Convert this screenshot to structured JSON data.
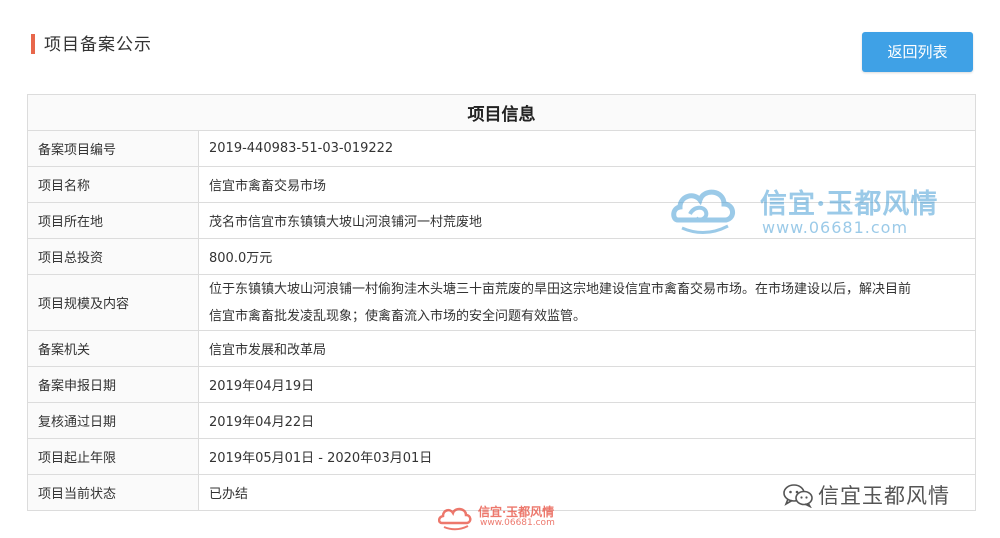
{
  "page": {
    "title": "项目备案公示",
    "back_button": "返回列表"
  },
  "table": {
    "heading": "项目信息",
    "rows": [
      {
        "label": "备案项目编号",
        "value": "2019-440983-51-03-019222"
      },
      {
        "label": "项目名称",
        "value": "信宜市禽畜交易市场"
      },
      {
        "label": "项目所在地",
        "value": "茂名市信宜市东镇镇大坡山河浪铺河一村荒废地"
      },
      {
        "label": "项目总投资",
        "value": "800.0万元"
      },
      {
        "label": "项目规模及内容",
        "value_line1": "位于东镇镇大坡山河浪铺一村偷狗洼木头塘三十亩荒废的旱田这宗地建设信宜市禽畜交易市场。在市场建设以后，解决目前",
        "value_line2": "信宜市禽畜批发凌乱现象；使禽畜流入市场的安全问题有效监管。"
      },
      {
        "label": "备案机关",
        "value": "信宜市发展和改革局"
      },
      {
        "label": "备案申报日期",
        "value": "2019年04月19日"
      },
      {
        "label": "复核通过日期",
        "value": "2019年04月22日"
      },
      {
        "label": "项目起止年限",
        "value": "2019年05月01日 - 2020年03月01日"
      },
      {
        "label": "项目当前状态",
        "value": "已办结"
      }
    ]
  },
  "watermarks": {
    "center_title": "信宜·玉都风情",
    "center_url": "www.06681.com",
    "bottom_title": "信宜·玉都风情",
    "bottom_url": "www.06681.com",
    "wechat_account": "信宜玉都风情"
  },
  "colors": {
    "accent_bar": "#e8674b",
    "button": "#3fa1e6",
    "watermark_blue": "#4a9fd6",
    "watermark_red": "#e74b3c"
  },
  "icons": {
    "cloud_logo": "cloud-logo-icon",
    "wechat": "wechat-icon"
  }
}
